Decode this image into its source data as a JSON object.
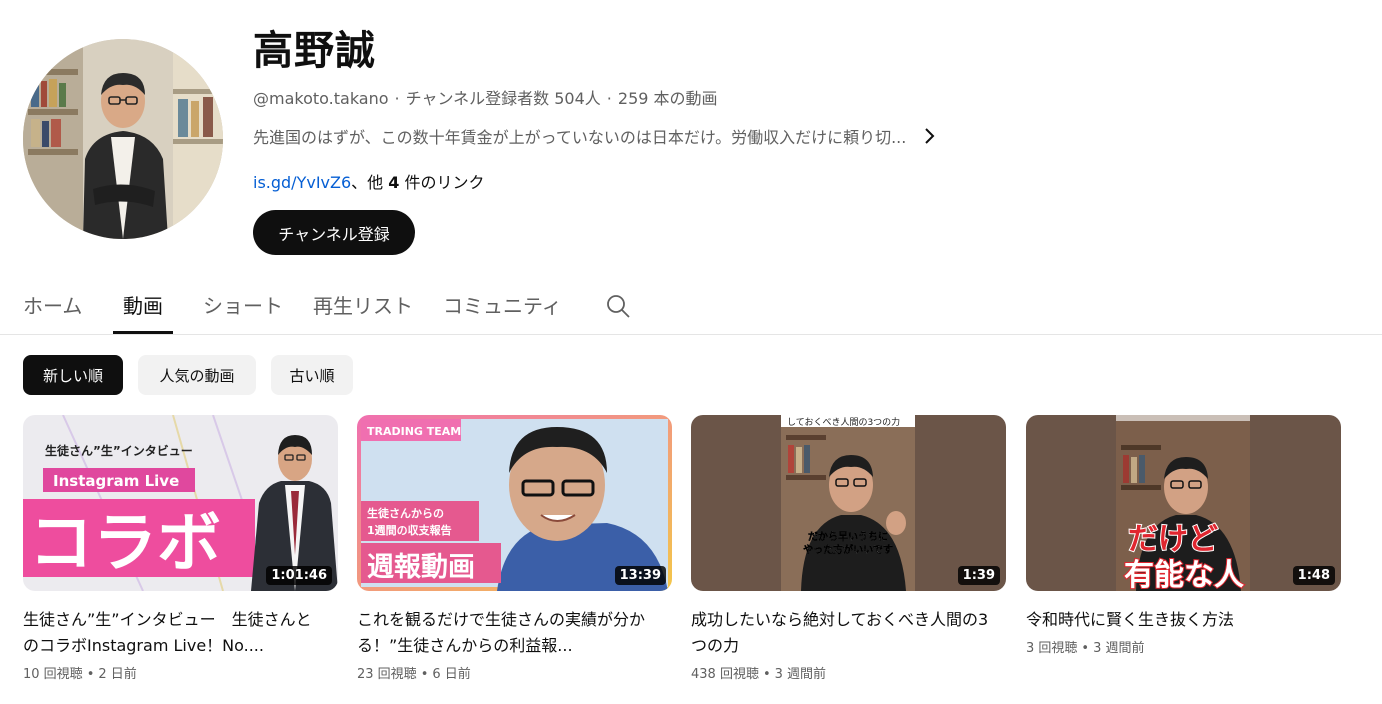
{
  "channel": {
    "name": "高野誠",
    "handle": "@makoto.takano",
    "meta_sep": "·",
    "subscribers": "チャンネル登録者数 504人",
    "video_count": "259 本の動画",
    "description": "先進国のはずが、この数十年賃金が上がっていないのは日本だけ。労働収入だけに頼り切...",
    "link_url_text": "is.gd/YvIvZ6",
    "link_suffix_pre": "、他 ",
    "link_count": "4",
    "link_suffix_post": " 件のリンク",
    "subscribe_label": "チャンネル登録"
  },
  "tabs": [
    {
      "label": "ホーム",
      "active": false
    },
    {
      "label": "動画",
      "active": true
    },
    {
      "label": "ショート",
      "active": false
    },
    {
      "label": "再生リスト",
      "active": false
    },
    {
      "label": "コミュニティ",
      "active": false
    }
  ],
  "chips": [
    {
      "label": "新しい順",
      "active": true
    },
    {
      "label": "人気の動画",
      "active": false
    },
    {
      "label": "古い順",
      "active": false
    }
  ],
  "videos": [
    {
      "title": "生徒さん”生”インタビュー　生徒さんとのコラボInstagram Live！No....",
      "duration": "1:01:46",
      "views": "10 回視聴",
      "age": "2 日前",
      "thumb_text": {
        "top": "生徒さん”生”インタビュー",
        "banner": "Instagram Live",
        "big": "コラボ"
      }
    },
    {
      "title": "これを観るだけで生徒さんの実績が分かる！”生徒さんからの利益報...",
      "duration": "13:39",
      "views": "23 回視聴",
      "age": "6 日前",
      "thumb_text": {
        "tag": "TRADING TEAM",
        "line1": "生徒さんからの",
        "line2": "1週間の収支報告",
        "big": "週報動画"
      }
    },
    {
      "title": "成功したいなら絶対しておくべき人間の3つの力",
      "duration": "1:39",
      "views": "438 回視聴",
      "age": "3 週間前",
      "thumb_text": {
        "top": "しておくべき人間の3つの力",
        "line1": "だから早いうちに",
        "line2": "やった方がいいです"
      }
    },
    {
      "title": "令和時代に賢く生き抜く方法",
      "duration": "1:48",
      "views": "3 回視聴",
      "age": "3 週間前",
      "thumb_text": {
        "line1": "だけど",
        "line2": "有能な人"
      }
    }
  ],
  "meta_dot": "•",
  "icons": {
    "more": "chevron-right-icon",
    "search": "search-icon"
  },
  "colors": {
    "link": "#065fd4",
    "text_primary": "#0f0f0f",
    "text_secondary": "#606060",
    "chip_bg": "#f2f2f2"
  }
}
